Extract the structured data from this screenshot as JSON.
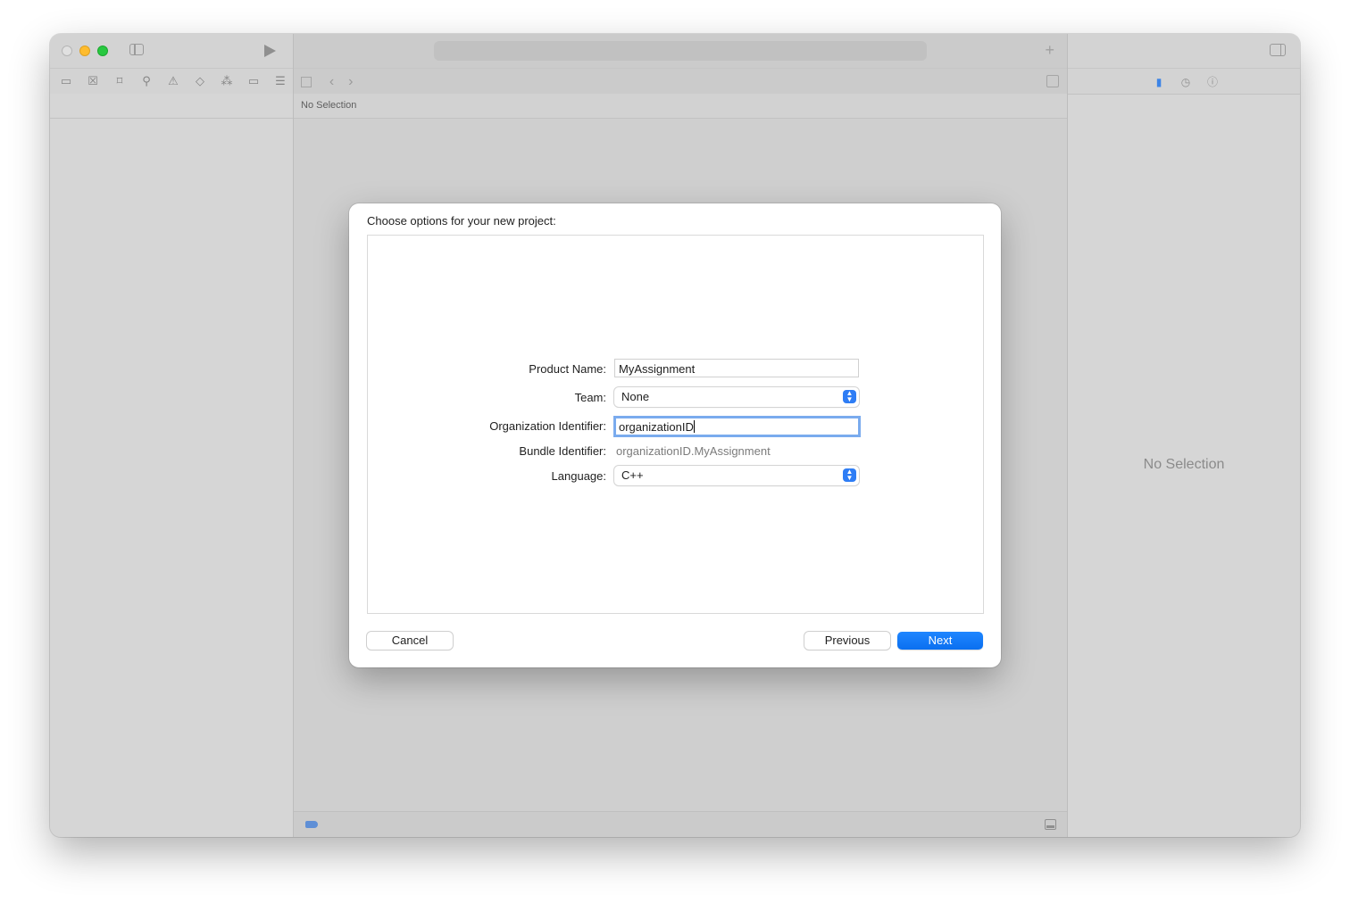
{
  "navigator": {
    "icons": [
      "folder-icon",
      "x-square-icon",
      "bookmark-icon",
      "search-icon",
      "warning-icon",
      "diamond-icon",
      "spray-icon",
      "tag-icon",
      "list-icon"
    ]
  },
  "editor": {
    "path_text": "No Selection"
  },
  "inspector": {
    "no_selection": "No Selection"
  },
  "sheet": {
    "title": "Choose options for your new project:",
    "fields": {
      "product_name": {
        "label": "Product Name:",
        "value": "MyAssignment"
      },
      "team": {
        "label": "Team:",
        "value": "None"
      },
      "organization_identifier": {
        "label": "Organization Identifier:",
        "value": "organizationID"
      },
      "bundle_identifier": {
        "label": "Bundle Identifier:",
        "value": "organizationID.MyAssignment"
      },
      "language": {
        "label": "Language:",
        "value": "C++"
      }
    },
    "buttons": {
      "cancel": "Cancel",
      "previous": "Previous",
      "next": "Next"
    }
  },
  "colors": {
    "accent": "#0a7aff",
    "focus_ring": "#7aabee"
  }
}
